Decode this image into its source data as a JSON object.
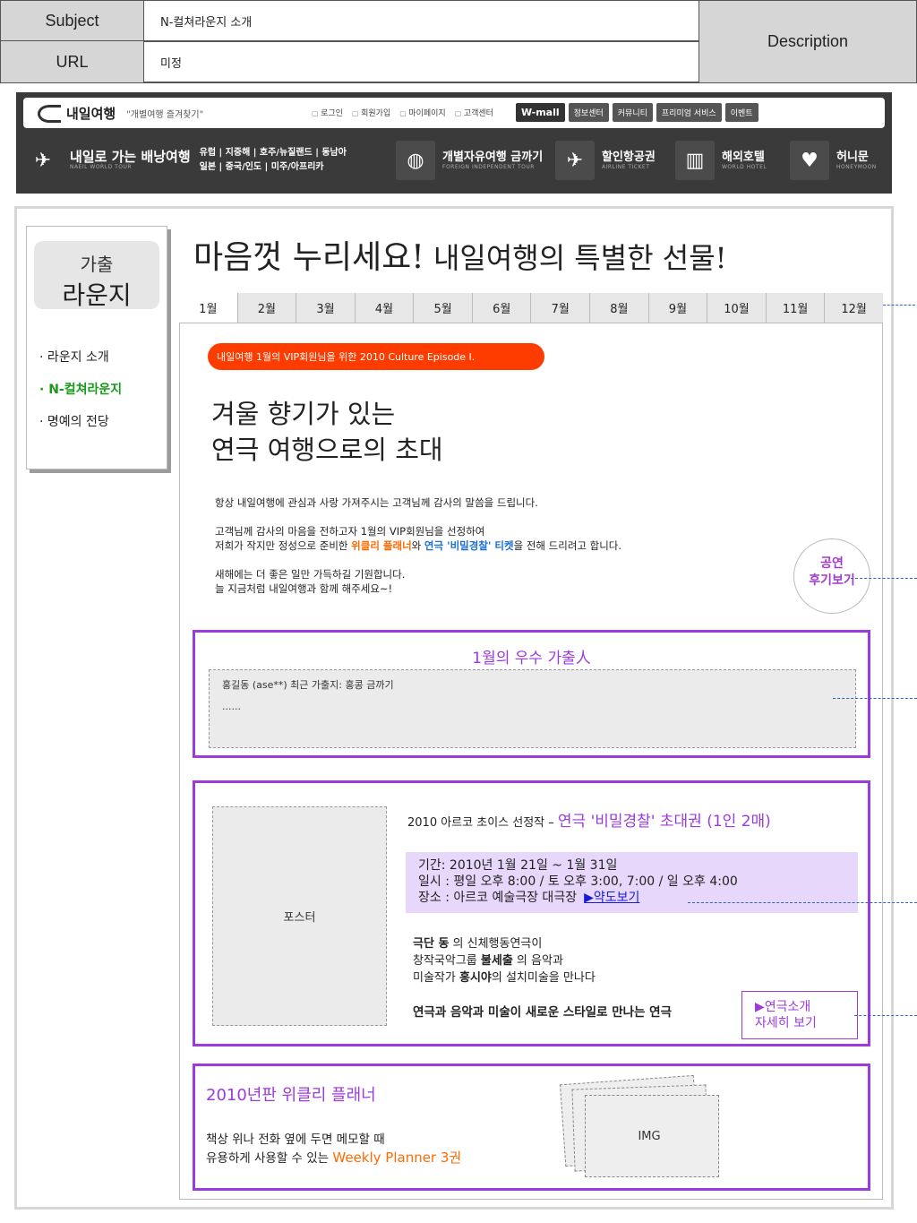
{
  "spec": {
    "subject_label": "Subject",
    "subject_value": "N-컬쳐라운지 소개",
    "url_label": "URL",
    "url_value": "미정",
    "description_label": "Description"
  },
  "header": {
    "logo_text": "내일여행",
    "slogan": "\"개별여행 즐겨찾기\"",
    "util_links": [
      "로그인",
      "회원가입",
      "마이페이지",
      "고객센터"
    ],
    "top_buttons": [
      "W-mall",
      "정보센터",
      "커뮤니티",
      "프리미엄 서비스",
      "이벤트"
    ],
    "nav": {
      "main_title": "내일로 가는 배낭여행",
      "main_sub": "NAEIL WORLD TOUR",
      "regions_line1": "유럽 | 지중해 | 호주/뉴질랜드 | 동남아",
      "regions_line2": "일본 | 중국/인도 | 미주/아프리카",
      "item1_title": "개별자유여행 금까기",
      "item1_sub": "FOREIGN INDEPENDENT TOUR",
      "item2_title": "할인항공권",
      "item2_sub": "AIRLINE TICKET",
      "item3_title": "해외호텔",
      "item3_sub": "WORLD HOTEL",
      "item4_title": "허니문",
      "item4_sub": "HONEYMOON"
    }
  },
  "sidebar": {
    "head_line1": "가출",
    "head_line2": "라운지",
    "items": [
      "· 라운지 소개",
      "· N-컬쳐라운지",
      "· 명예의 전당"
    ],
    "active_index": 1
  },
  "hero": {
    "title_part1": "마음껏 누리세요!",
    "title_part2": " 내일여행의 특별한 선물!"
  },
  "tabs": [
    "1월",
    "2월",
    "3월",
    "4월",
    "5월",
    "6월",
    "7월",
    "8월",
    "9월",
    "10월",
    "11월",
    "12월"
  ],
  "active_tab": 0,
  "episode_pill": "내일여행 1월의 VIP회원님을 위한 2010 Culture Episode Ⅰ.",
  "invite": {
    "line1": "겨울 향기가 있는",
    "line2": "연극 여행으로의 초대"
  },
  "message": {
    "p1": "항상 내일여행에 관심과 사랑 가져주시는 고객님께 감사의 말씀을 드립니다.",
    "p2_line1": "고객님께 감사의 마음을 전하고자 1월의 VIP회원님을 선정하여",
    "p2_line2_a": "저희가 작지만 정성으로 준비한 ",
    "p2_line2_b": "위클리 플래너",
    "p2_line2_c": "와 ",
    "p2_line2_d": "연극 '비밀경찰' 티켓",
    "p2_line2_e": "을 전해 드리려고 합니다.",
    "p3_line1": "새해에는 더 좋은 일만 가득하길 기원합니다.",
    "p3_line2": "늘 지금처럼 내일여행과 함께 해주세요~!"
  },
  "review_button": {
    "line1": "공연",
    "line2": "후기보기"
  },
  "best": {
    "title": "1월의 우수 가출人",
    "entry": "홍길동 (ase**) 최근 가출지: 홍콩 금까기",
    "more": "......"
  },
  "show": {
    "poster_label": "포스터",
    "prefix": "2010 아르코 초이스 선정작 – ",
    "title": "연극 '비밀경찰' 초대권 (1인 2매)",
    "period": "기간: 2010년 1월 21일 ~ 1월 31일",
    "time": "일시 : 평일 오후 8:00 / 토 오후 3:00, 7:00 / 일 오후 4:00",
    "place": "장소 : 아르코 예술극장 대극장",
    "map_link": "▶약도보기",
    "desc1_bold": "극단 동",
    "desc1_rest": " 의 신체행동연극이",
    "desc2_a": "창작국악그룹 ",
    "desc2_bold": "불세출",
    "desc2_rest": " 의 음악과",
    "desc3_a": "미술작가 ",
    "desc3_bold": "홍시야",
    "desc3_rest": "의 설치미술을 만나다",
    "tagline": "연극과 음악과 미술이 새로운 스타일로 만나는 연극",
    "detail_line1": "▶연극소개",
    "detail_line2": "자세히 보기"
  },
  "planner": {
    "title": "2010년판 위클리 플래너",
    "line1": "책상 위나 전화 옆에 두면 메모할 때",
    "line2_a": "유용하게 사용할 수 있는 ",
    "line2_b": "Weekly Planner 3권",
    "img_label": "IMG"
  }
}
